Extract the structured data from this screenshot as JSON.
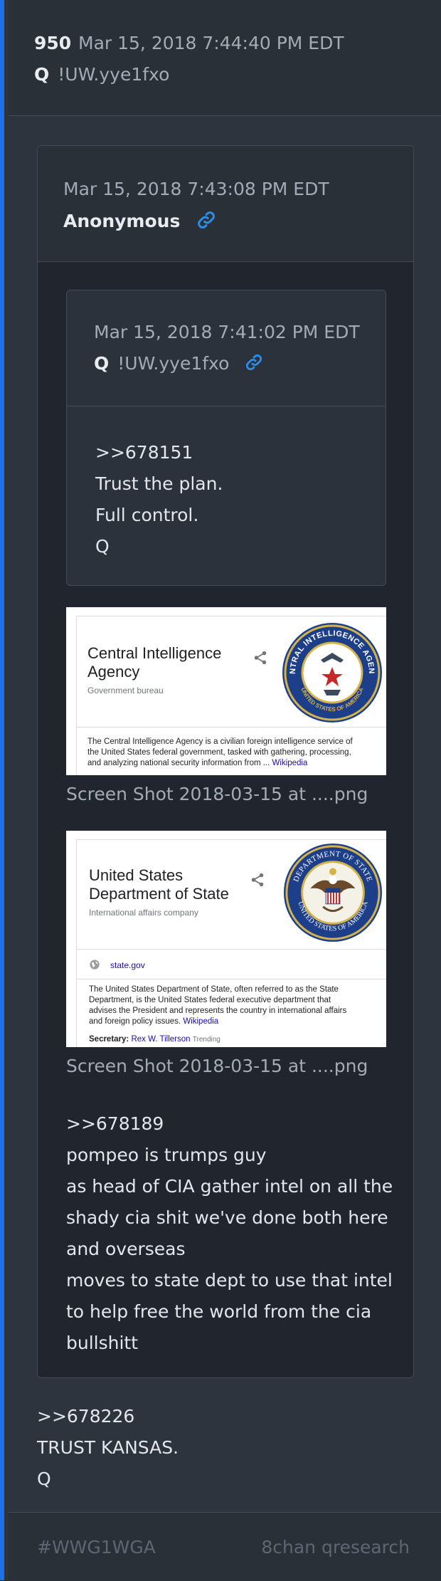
{
  "post": {
    "number": "950",
    "timestamp": "Mar 15, 2018 7:44:40 PM EDT",
    "author": "Q",
    "tripcode": "!UW.yye1fxo",
    "body_lines": [
      ">>678226",
      "TRUST KANSAS.",
      "Q"
    ]
  },
  "quoted_post": {
    "timestamp": "Mar 15, 2018 7:43:08 PM EDT",
    "author": "Anonymous",
    "body_lines": [
      ">>678189",
      "pompeo is trumps guy",
      "as head of CIA gather intel on all the",
      "shady cia shit we've done both here",
      "and overseas",
      "moves to state dept to use that intel",
      "to help free the world from the cia",
      "bullshitt"
    ]
  },
  "nested_post": {
    "timestamp": "Mar 15, 2018 7:41:02 PM EDT",
    "author": "Q",
    "tripcode": "!UW.yye1fxo",
    "body_lines": [
      ">>678151",
      "Trust the plan.",
      "Full control.",
      "Q"
    ]
  },
  "images": [
    {
      "caption": "Screen Shot 2018-03-15 at ....png",
      "title_lines": [
        "Central Intelligence",
        "Agency"
      ],
      "subtitle": "Government bureau",
      "desc_lines": [
        "The Central Intelligence Agency is a civilian foreign intelligence service of",
        "the United States federal government, tasked with gathering, processing,",
        "and analyzing national security information from ..."
      ],
      "wiki": "Wikipedia",
      "seal_top": "CENTRAL INTELLIGENCE AGENCY",
      "seal_bottom": "UNITED STATES OF AMERICA",
      "seal_color": "#1d3f8a"
    },
    {
      "caption": "Screen Shot 2018-03-15 at ....png",
      "title_lines": [
        "United States",
        "Department of State"
      ],
      "subtitle": "International affairs company",
      "website": "state.gov",
      "desc_lines": [
        "The United States Department of State, often referred to as the State",
        "Department, is the United States federal executive department that",
        "advises the President and represents the country in international affairs",
        "and foreign policy issues."
      ],
      "wiki": "Wikipedia",
      "secretary_label": "Secretary:",
      "secretary_name": "Rex W. Tillerson",
      "secretary_badge": "Trending",
      "seal_top": "DEPARTMENT OF STATE",
      "seal_bottom": "UNITED STATES OF AMERICA",
      "seal_color": "#1d3f8a"
    }
  ],
  "footer": {
    "hashtag": "#WWG1WGA",
    "source": "8chan qresearch"
  },
  "colors": {
    "accent": "#1a73e8",
    "link_icon": "#2f8be6",
    "muted_text": "#a3acb6"
  }
}
